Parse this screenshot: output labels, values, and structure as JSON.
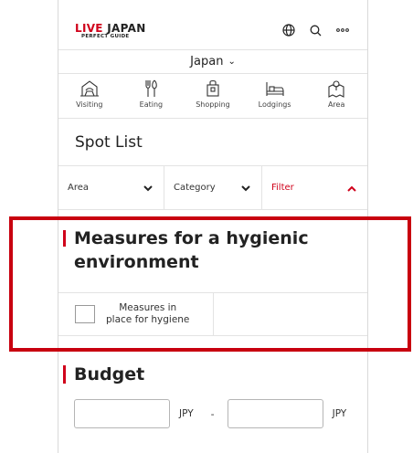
{
  "header": {
    "logo_accent": "LIVE",
    "logo_main": " JAPAN",
    "logo_sub": "PERFECT GUIDE"
  },
  "country_selector": {
    "label": "Japan",
    "chevron": "⌄"
  },
  "categories": [
    {
      "label": "Visiting",
      "icon": "mountain-icon"
    },
    {
      "label": "Eating",
      "icon": "utensils-icon"
    },
    {
      "label": "Shopping",
      "icon": "shopping-bag-icon"
    },
    {
      "label": "Lodgings",
      "icon": "bed-icon"
    },
    {
      "label": "Area",
      "icon": "map-pin-icon"
    }
  ],
  "spot_list": {
    "title": "Spot List"
  },
  "filters": {
    "area": "Area",
    "category": "Category",
    "filter": "Filter"
  },
  "hygiene": {
    "title_line1": "Measures for a hygienic",
    "title_line2": "environment",
    "checkbox_line1": "Measures in",
    "checkbox_line2": "place for hygiene",
    "checked": false
  },
  "budget": {
    "title": "Budget",
    "min_value": "",
    "max_value": "",
    "unit": "JPY",
    "separator": "-"
  },
  "colors": {
    "brand_red": "#d0021b",
    "highlight_red": "#c8000f"
  }
}
